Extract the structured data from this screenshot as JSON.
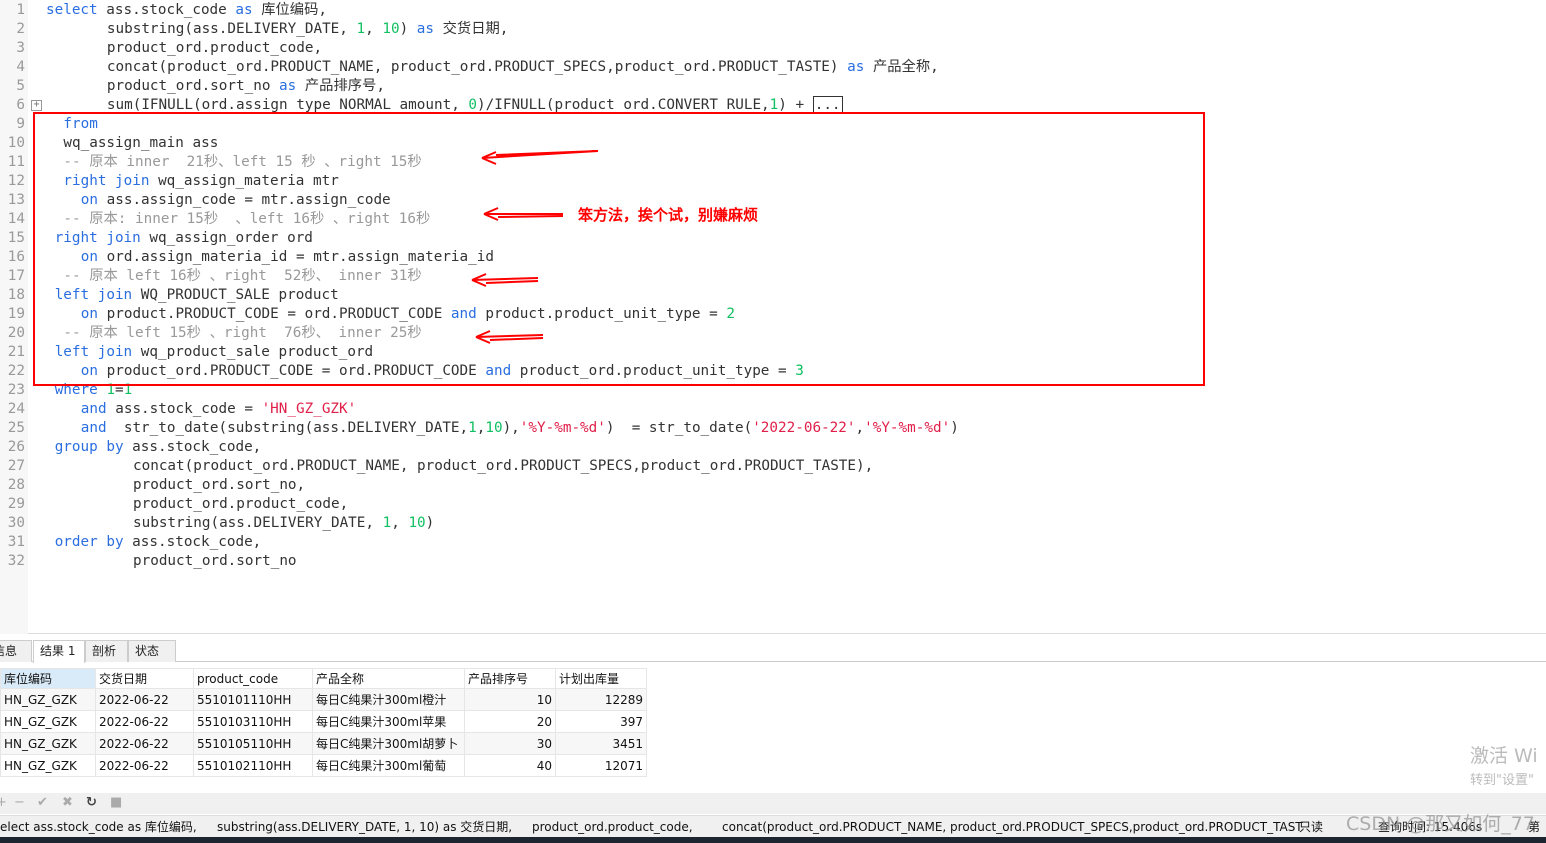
{
  "editor": {
    "lines": [
      {
        "no": "1",
        "indent": 0,
        "tokens": [
          [
            "k",
            "select"
          ],
          [
            "t",
            " ass.stock_code "
          ],
          [
            "k",
            "as"
          ],
          [
            "t",
            " 库位编码,"
          ]
        ]
      },
      {
        "no": "2",
        "indent": 7,
        "tokens": [
          [
            "t",
            "substring(ass.DELIVERY_DATE, "
          ],
          [
            "n",
            "1"
          ],
          [
            "t",
            ", "
          ],
          [
            "n",
            "10"
          ],
          [
            "t",
            ") "
          ],
          [
            "k",
            "as"
          ],
          [
            "t",
            " 交货日期,"
          ]
        ]
      },
      {
        "no": "3",
        "indent": 7,
        "tokens": [
          [
            "t",
            "product_ord.product_code,"
          ]
        ]
      },
      {
        "no": "4",
        "indent": 7,
        "tokens": [
          [
            "t",
            "concat(product_ord.PRODUCT_NAME, product_ord.PRODUCT_SPECS,product_ord.PRODUCT_TASTE) "
          ],
          [
            "k",
            "as"
          ],
          [
            "t",
            " 产品全称,"
          ]
        ]
      },
      {
        "no": "5",
        "indent": 7,
        "tokens": [
          [
            "t",
            "product_ord.sort_no "
          ],
          [
            "k",
            "as"
          ],
          [
            "t",
            " 产品排序号,"
          ]
        ]
      },
      {
        "no": "6",
        "indent": 7,
        "fold": true,
        "tokens": [
          [
            "t",
            "sum(IFNULL(ord.assign_type_NORMAL_amount, "
          ],
          [
            "n",
            "0"
          ],
          [
            "t",
            ")/IFNULL(product_ord.CONVERT_RULE,"
          ],
          [
            "n",
            "1"
          ],
          [
            "t",
            ") + "
          ],
          [
            "e",
            "..."
          ]
        ]
      },
      {
        "no": "9",
        "indent": 2,
        "tokens": [
          [
            "k",
            "from"
          ]
        ]
      },
      {
        "no": "10",
        "indent": 2,
        "tokens": [
          [
            "t",
            "wq_assign_main ass"
          ]
        ]
      },
      {
        "no": "11",
        "indent": 2,
        "tokens": [
          [
            "c",
            "-- 原本 inner  21秒、left 15 秒 、right 15秒"
          ]
        ]
      },
      {
        "no": "12",
        "indent": 2,
        "tokens": [
          [
            "k",
            "right join"
          ],
          [
            "t",
            " wq_assign_materia mtr"
          ]
        ]
      },
      {
        "no": "13",
        "indent": 4,
        "tokens": [
          [
            "k",
            "on"
          ],
          [
            "t",
            " ass.assign_code = mtr.assign_code"
          ]
        ]
      },
      {
        "no": "14",
        "indent": 2,
        "tokens": [
          [
            "c",
            "-- 原本: inner 15秒  、left 16秒 、right 16秒"
          ]
        ]
      },
      {
        "no": "15",
        "indent": 1,
        "tokens": [
          [
            "k",
            "right join"
          ],
          [
            "t",
            " wq_assign_order ord"
          ]
        ]
      },
      {
        "no": "16",
        "indent": 4,
        "tokens": [
          [
            "k",
            "on"
          ],
          [
            "t",
            " ord.assign_materia_id = mtr.assign_materia_id"
          ]
        ]
      },
      {
        "no": "17",
        "indent": 2,
        "tokens": [
          [
            "c",
            "-- 原本 left 16秒 、right  52秒、 inner 31秒"
          ]
        ]
      },
      {
        "no": "18",
        "indent": 1,
        "tokens": [
          [
            "k",
            "left join"
          ],
          [
            "t",
            " WQ_PRODUCT_SALE product"
          ]
        ]
      },
      {
        "no": "19",
        "indent": 4,
        "tokens": [
          [
            "k",
            "on"
          ],
          [
            "t",
            " product.PRODUCT_CODE = ord.PRODUCT_CODE "
          ],
          [
            "k",
            "and"
          ],
          [
            "t",
            " product.product_unit_type = "
          ],
          [
            "n",
            "2"
          ]
        ]
      },
      {
        "no": "20",
        "indent": 2,
        "tokens": [
          [
            "c",
            "-- 原本 left 15秒 、right  76秒、 inner 25秒"
          ]
        ]
      },
      {
        "no": "21",
        "indent": 1,
        "tokens": [
          [
            "k",
            "left join"
          ],
          [
            "t",
            " wq_product_sale product_ord"
          ]
        ]
      },
      {
        "no": "22",
        "indent": 4,
        "tokens": [
          [
            "k",
            "on"
          ],
          [
            "t",
            " product_ord.PRODUCT_CODE = ord.PRODUCT_CODE "
          ],
          [
            "k",
            "and"
          ],
          [
            "t",
            " product_ord.product_unit_type = "
          ],
          [
            "n",
            "3"
          ]
        ]
      },
      {
        "no": "23",
        "indent": 1,
        "tokens": [
          [
            "k",
            "where"
          ],
          [
            "t",
            " "
          ],
          [
            "n",
            "1"
          ],
          [
            "t",
            "="
          ],
          [
            "n",
            "1"
          ]
        ]
      },
      {
        "no": "24",
        "indent": 4,
        "tokens": [
          [
            "k",
            "and"
          ],
          [
            "t",
            " ass.stock_code = "
          ],
          [
            "s",
            "'HN_GZ_GZK'"
          ]
        ]
      },
      {
        "no": "25",
        "indent": 4,
        "tokens": [
          [
            "k",
            "and"
          ],
          [
            "t",
            "  str_to_date(substring(ass.DELIVERY_DATE,"
          ],
          [
            "n",
            "1"
          ],
          [
            "t",
            ","
          ],
          [
            "n",
            "10"
          ],
          [
            "t",
            "),"
          ],
          [
            "s",
            "'%Y-%m-%d'"
          ],
          [
            "t",
            ")  = str_to_date("
          ],
          [
            "s",
            "'2022-06-22'"
          ],
          [
            "t",
            ","
          ],
          [
            "s",
            "'%Y-%m-%d'"
          ],
          [
            "t",
            ")"
          ]
        ]
      },
      {
        "no": "26",
        "indent": 1,
        "tokens": [
          [
            "k",
            "group by"
          ],
          [
            "t",
            " ass.stock_code,"
          ]
        ]
      },
      {
        "no": "27",
        "indent": 10,
        "tokens": [
          [
            "t",
            "concat(product_ord.PRODUCT_NAME, product_ord.PRODUCT_SPECS,product_ord.PRODUCT_TASTE),"
          ]
        ]
      },
      {
        "no": "28",
        "indent": 10,
        "tokens": [
          [
            "t",
            "product_ord.sort_no,"
          ]
        ]
      },
      {
        "no": "29",
        "indent": 10,
        "tokens": [
          [
            "t",
            "product_ord.product_code,"
          ]
        ]
      },
      {
        "no": "30",
        "indent": 10,
        "tokens": [
          [
            "t",
            "substring(ass.DELIVERY_DATE, "
          ],
          [
            "n",
            "1"
          ],
          [
            "t",
            ", "
          ],
          [
            "n",
            "10"
          ],
          [
            "t",
            ")"
          ]
        ]
      },
      {
        "no": "31",
        "indent": 1,
        "tokens": [
          [
            "k",
            "order by"
          ],
          [
            "t",
            " ass.stock_code,"
          ]
        ]
      },
      {
        "no": "32",
        "indent": 10,
        "tokens": [
          [
            "t",
            "product_ord.sort_no"
          ]
        ]
      }
    ]
  },
  "annotation": {
    "note": "笨方法，挨个试，别嫌麻烦",
    "color": "#ff0000"
  },
  "tabs": [
    "信息",
    "结果 1",
    "剖析",
    "状态"
  ],
  "results": {
    "columns": [
      "库位编码",
      "交货日期",
      "product_code",
      "产品全称",
      "产品排序号",
      "计划出库量"
    ],
    "rows": [
      [
        "HN_GZ_GZK",
        "2022-06-22",
        "5510101110HH",
        "每日C纯果汁300ml橙汁",
        "10",
        "12289"
      ],
      [
        "HN_GZ_GZK",
        "2022-06-22",
        "5510103110HH",
        "每日C纯果汁300ml苹果",
        "20",
        "397"
      ],
      [
        "HN_GZ_GZK",
        "2022-06-22",
        "5510105110HH",
        "每日C纯果汁300ml胡萝卜",
        "30",
        "3451"
      ],
      [
        "HN_GZ_GZK",
        "2022-06-22",
        "5510102110HH",
        "每日C纯果汁300ml葡萄",
        "40",
        "12071"
      ]
    ]
  },
  "toolbar": {
    "icons": [
      "add-icon",
      "remove-icon",
      "apply-icon",
      "discard-icon",
      "refresh-icon",
      "stop-icon"
    ]
  },
  "status": {
    "sql1": "elect ass.stock_code as 库位编码,",
    "sql2": "substring(ass.DELIVERY_DATE, 1, 10) as 交货日期,",
    "sql3": "product_ord.product_code,",
    "sql4": "concat(product_ord.PRODUCT_NAME, product_ord.PRODUCT_SPECS,product_ord.PRODUCT_TAST",
    "readonly": "只读",
    "query_time": "查询时间: 15.406s",
    "page": "第"
  },
  "watermarks": {
    "activate_title": "激活 Wi",
    "activate_sub": "转到\"设置\"",
    "csdn": "CSDN @那又如何_77"
  }
}
